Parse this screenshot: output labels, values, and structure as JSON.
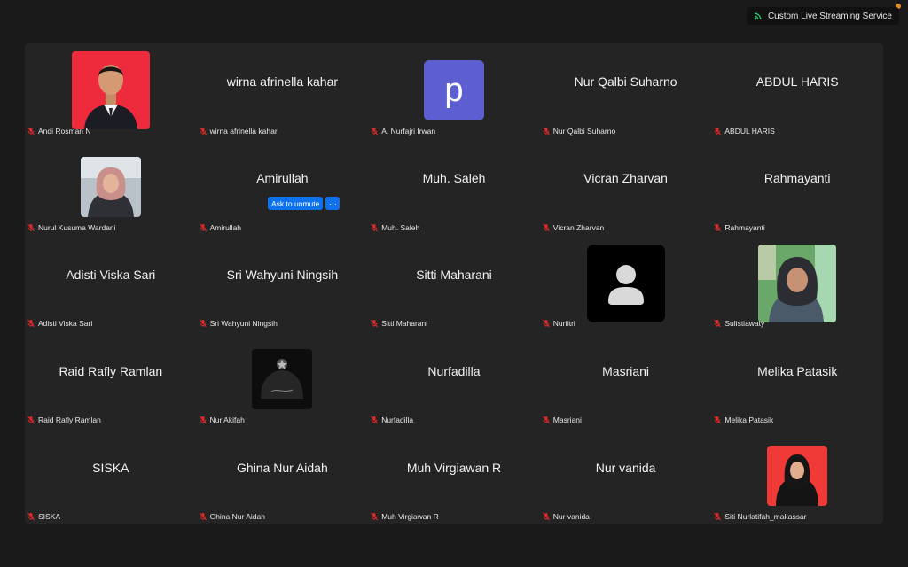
{
  "stream_badge": {
    "label": "Custom Live Streaming Service",
    "icon": "live-stream-icon",
    "color": "#2ecc71"
  },
  "unmute": {
    "label": "Ask to unmute",
    "more_label": "···"
  },
  "colors": {
    "tile_bg": "#242424",
    "avatar_p": "#5d5fd0",
    "muted_icon": "#e02828",
    "accent_button": "#0e72ed"
  },
  "participants": [
    {
      "name": "Andi Rosman N",
      "display": "",
      "type": "photo-red"
    },
    {
      "name": "wirna afrinella kahar",
      "display": "wirna afrinella kahar",
      "type": "name"
    },
    {
      "name": "A. Nurfajri Irwan",
      "display": "",
      "type": "letter",
      "letter": "p"
    },
    {
      "name": "Nur Qalbi Suharno",
      "display": "Nur Qalbi Suharno",
      "type": "name"
    },
    {
      "name": "ABDUL HARIS",
      "display": "ABDUL HARIS",
      "type": "name"
    },
    {
      "name": "Nurul Kusuma Wardani",
      "display": "",
      "type": "photo-hijab"
    },
    {
      "name": "Amirullah",
      "display": "Amirullah",
      "type": "name"
    },
    {
      "name": "Muh. Saleh",
      "display": "Muh. Saleh",
      "type": "name"
    },
    {
      "name": "Vicran Zharvan",
      "display": "Vicran Zharvan",
      "type": "name"
    },
    {
      "name": "Rahmayanti",
      "display": "Rahmayanti",
      "type": "name"
    },
    {
      "name": "Adisti Viska Sari",
      "display": "Adisti Viska Sari",
      "type": "name"
    },
    {
      "name": "Sri Wahyuni Ningsih",
      "display": "Sri Wahyuni Ningsih",
      "type": "name"
    },
    {
      "name": "Sitti Maharani",
      "display": "Sitti Maharani",
      "type": "name"
    },
    {
      "name": "Nurfitri",
      "display": "",
      "type": "generic"
    },
    {
      "name": "Sulistiawaty",
      "display": "",
      "type": "photo-sulis"
    },
    {
      "name": "Raid Rafly Ramlan",
      "display": "Raid Rafly Ramlan",
      "type": "name"
    },
    {
      "name": "Nur Akifah",
      "display": "",
      "type": "photo-dark"
    },
    {
      "name": "Nurfadilla",
      "display": "Nurfadilla",
      "type": "name"
    },
    {
      "name": "Masriani",
      "display": "Masriani",
      "type": "name"
    },
    {
      "name": "Melika Patasik",
      "display": "Melika Patasik",
      "type": "name"
    },
    {
      "name": "SISKA",
      "display": "SISKA",
      "type": "name"
    },
    {
      "name": "Ghina Nur Aidah",
      "display": "Ghina Nur Aidah",
      "type": "name"
    },
    {
      "name": "Muh Virgiawan R",
      "display": "Muh Virgiawan R",
      "type": "name"
    },
    {
      "name": "Nur vanida",
      "display": "Nur vanida",
      "type": "name"
    },
    {
      "name": "Siti Nurlatifah_makassar",
      "display": "",
      "type": "photo-red-hijab"
    }
  ]
}
